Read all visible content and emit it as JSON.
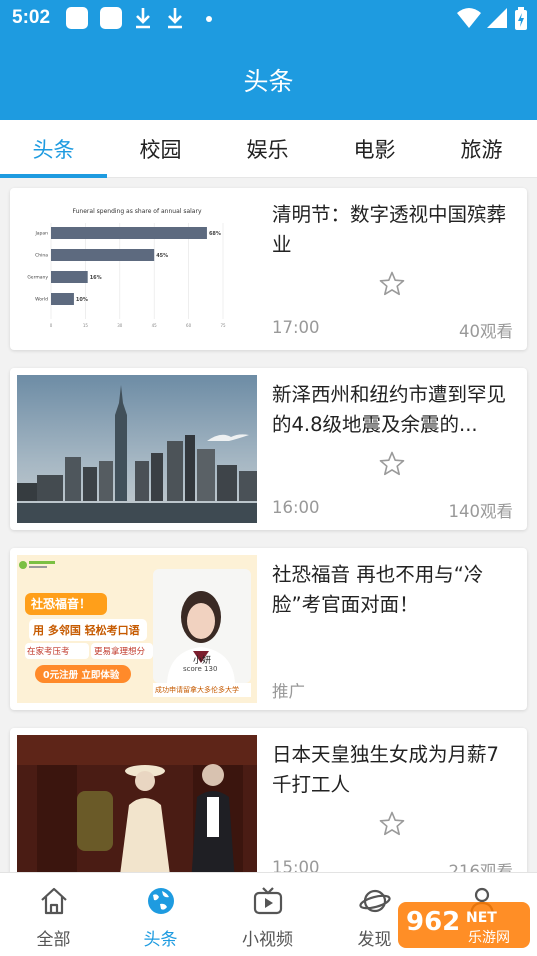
{
  "status_bar": {
    "time": "5:02"
  },
  "header": {
    "title": "头条"
  },
  "tabs": [
    {
      "label": "头条",
      "active": true
    },
    {
      "label": "校园"
    },
    {
      "label": "娱乐"
    },
    {
      "label": "电影"
    },
    {
      "label": "旅游"
    }
  ],
  "chart_data": {
    "type": "bar",
    "title": "Funeral spending as share of annual salary",
    "categories": [
      "Japan",
      "China",
      "Germany",
      "World"
    ],
    "values": [
      68,
      45,
      16,
      10
    ],
    "value_labels": [
      "68%",
      "45%",
      "16%",
      "10%"
    ],
    "xlim": [
      0,
      75
    ],
    "x_ticks": [
      "0",
      "15",
      "30",
      "45",
      "60",
      "75"
    ],
    "orientation": "horizontal",
    "bar_color": "#5d6a7f"
  },
  "ad_image": {
    "headline_line1": "社恐福音！",
    "headline_line2": "用 多邻国 轻松考口语",
    "tag_left": "在家考压考",
    "tag_right": "更易拿理想分",
    "cta": "0元注册 立即体验",
    "person_name": "小妍",
    "score": "score 130",
    "caption": "成功申请留拿大多伦多大学"
  },
  "feed": [
    {
      "headline": "清明节：数字透视中国殡葬业",
      "time": "17:00",
      "views": "40观看"
    },
    {
      "headline": "新泽西州和纽约市遭到罕见的4.8级地震及余震的...",
      "time": "16:00",
      "views": "140观看"
    },
    {
      "headline": "社恐福音 再也不用与“冷脸”考官面对面！",
      "time": "推广",
      "views": ""
    },
    {
      "headline": "日本天皇独生女成为月薪7千打工人",
      "time": "15:00",
      "views": "216观看"
    }
  ],
  "bottom_nav": [
    {
      "label": "全部",
      "icon": "home-icon"
    },
    {
      "label": "头条",
      "icon": "globe-icon",
      "active": true
    },
    {
      "label": "小视频",
      "icon": "tv-icon"
    },
    {
      "label": "发现",
      "icon": "planet-icon"
    },
    {
      "label": "",
      "icon": "person-icon"
    }
  ],
  "watermark": {
    "text": "962",
    "sub": "NET",
    "site": "乐游网"
  },
  "colors": {
    "accent": "#1e9be0"
  }
}
